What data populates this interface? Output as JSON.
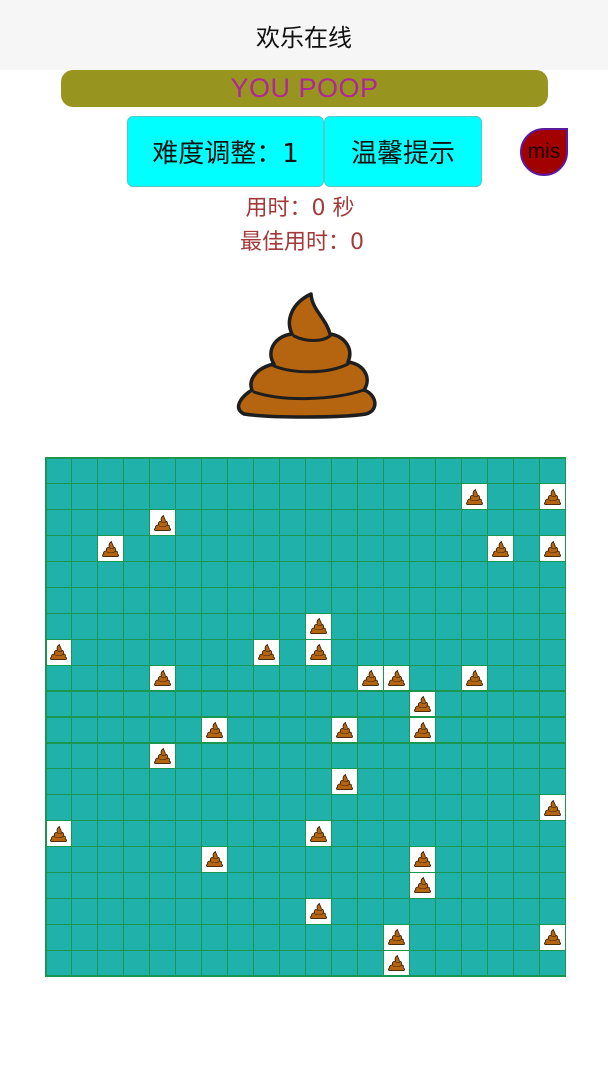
{
  "header": {
    "title": "欢乐在线"
  },
  "banner": {
    "text": "YOU POOP"
  },
  "controls": {
    "difficulty_label": "难度调整：1",
    "hint_label": "温馨提示",
    "mis_label": "mis"
  },
  "stats": {
    "time_text": "用时：0 秒",
    "best_text": "最佳用时：0"
  },
  "status_icon": "poop-icon",
  "board": {
    "rows": 20,
    "cols": 20,
    "revealed_mine_icon": "poop-icon",
    "mines": [
      [
        1,
        16
      ],
      [
        1,
        19
      ],
      [
        2,
        4
      ],
      [
        3,
        2
      ],
      [
        3,
        17
      ],
      [
        3,
        19
      ],
      [
        6,
        10
      ],
      [
        7,
        0
      ],
      [
        7,
        8
      ],
      [
        7,
        10
      ],
      [
        8,
        4
      ],
      [
        8,
        12
      ],
      [
        8,
        13
      ],
      [
        8,
        16
      ],
      [
        9,
        14
      ],
      [
        10,
        6
      ],
      [
        10,
        11
      ],
      [
        10,
        14
      ],
      [
        11,
        4
      ],
      [
        12,
        11
      ],
      [
        13,
        19
      ],
      [
        14,
        0
      ],
      [
        14,
        10
      ],
      [
        15,
        6
      ],
      [
        15,
        14
      ],
      [
        16,
        14
      ],
      [
        17,
        10
      ],
      [
        18,
        13
      ],
      [
        18,
        19
      ],
      [
        19,
        13
      ]
    ]
  },
  "colors": {
    "banner_bg": "#979420",
    "banner_text": "#b0279a",
    "button_bg": "#00ffff",
    "mis_bg": "#a30000",
    "stat_text": "#a33a3a",
    "cell": "#20b2aa",
    "grid_line": "#1a9650"
  }
}
